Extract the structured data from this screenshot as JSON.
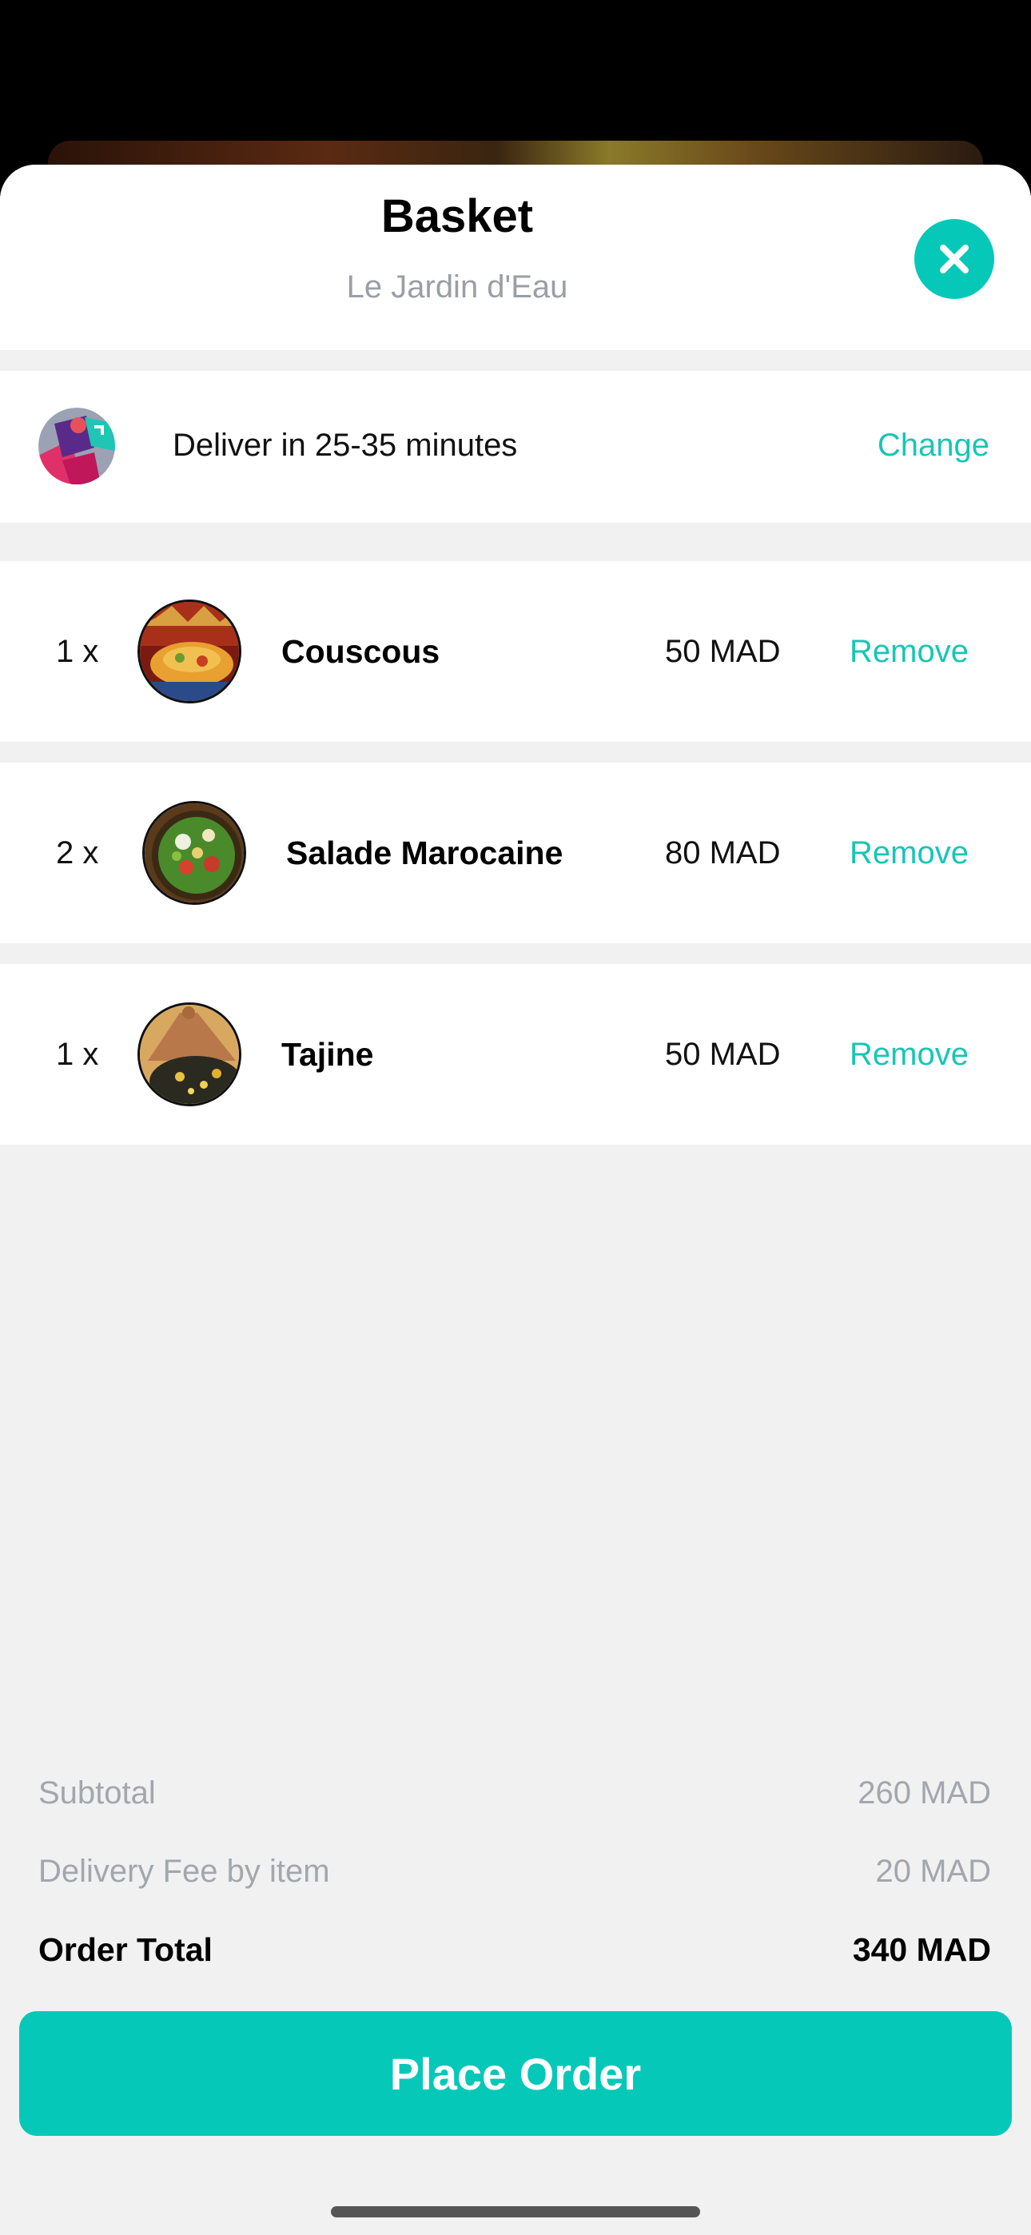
{
  "header": {
    "title": "Basket",
    "restaurant": "Le Jardin d'Eau",
    "close_icon": "close-icon"
  },
  "delivery": {
    "text": "Deliver in 25-35 minutes",
    "change_label": "Change",
    "avatar_icon": "courier-avatar"
  },
  "items": [
    {
      "qty": "1 x",
      "name": "Couscous",
      "price": "50 MAD",
      "remove_label": "Remove",
      "image": "couscous-image"
    },
    {
      "qty": "2 x",
      "name": "Salade Marocaine",
      "price": "80 MAD",
      "remove_label": "Remove",
      "image": "salad-image"
    },
    {
      "qty": "1 x",
      "name": "Tajine",
      "price": "50 MAD",
      "remove_label": "Remove",
      "image": "tajine-image"
    }
  ],
  "summary": {
    "subtotal_label": "Subtotal",
    "subtotal_value": "260 MAD",
    "fee_label": "Delivery Fee by item",
    "fee_value": "20 MAD",
    "total_label": "Order Total",
    "total_value": "340 MAD"
  },
  "cta": {
    "place_order_label": "Place Order"
  },
  "colors": {
    "accent": "#05c8b8",
    "accent_text": "#17c6b5",
    "muted_text": "#a2a6ad",
    "background": "#f1f1f2"
  }
}
